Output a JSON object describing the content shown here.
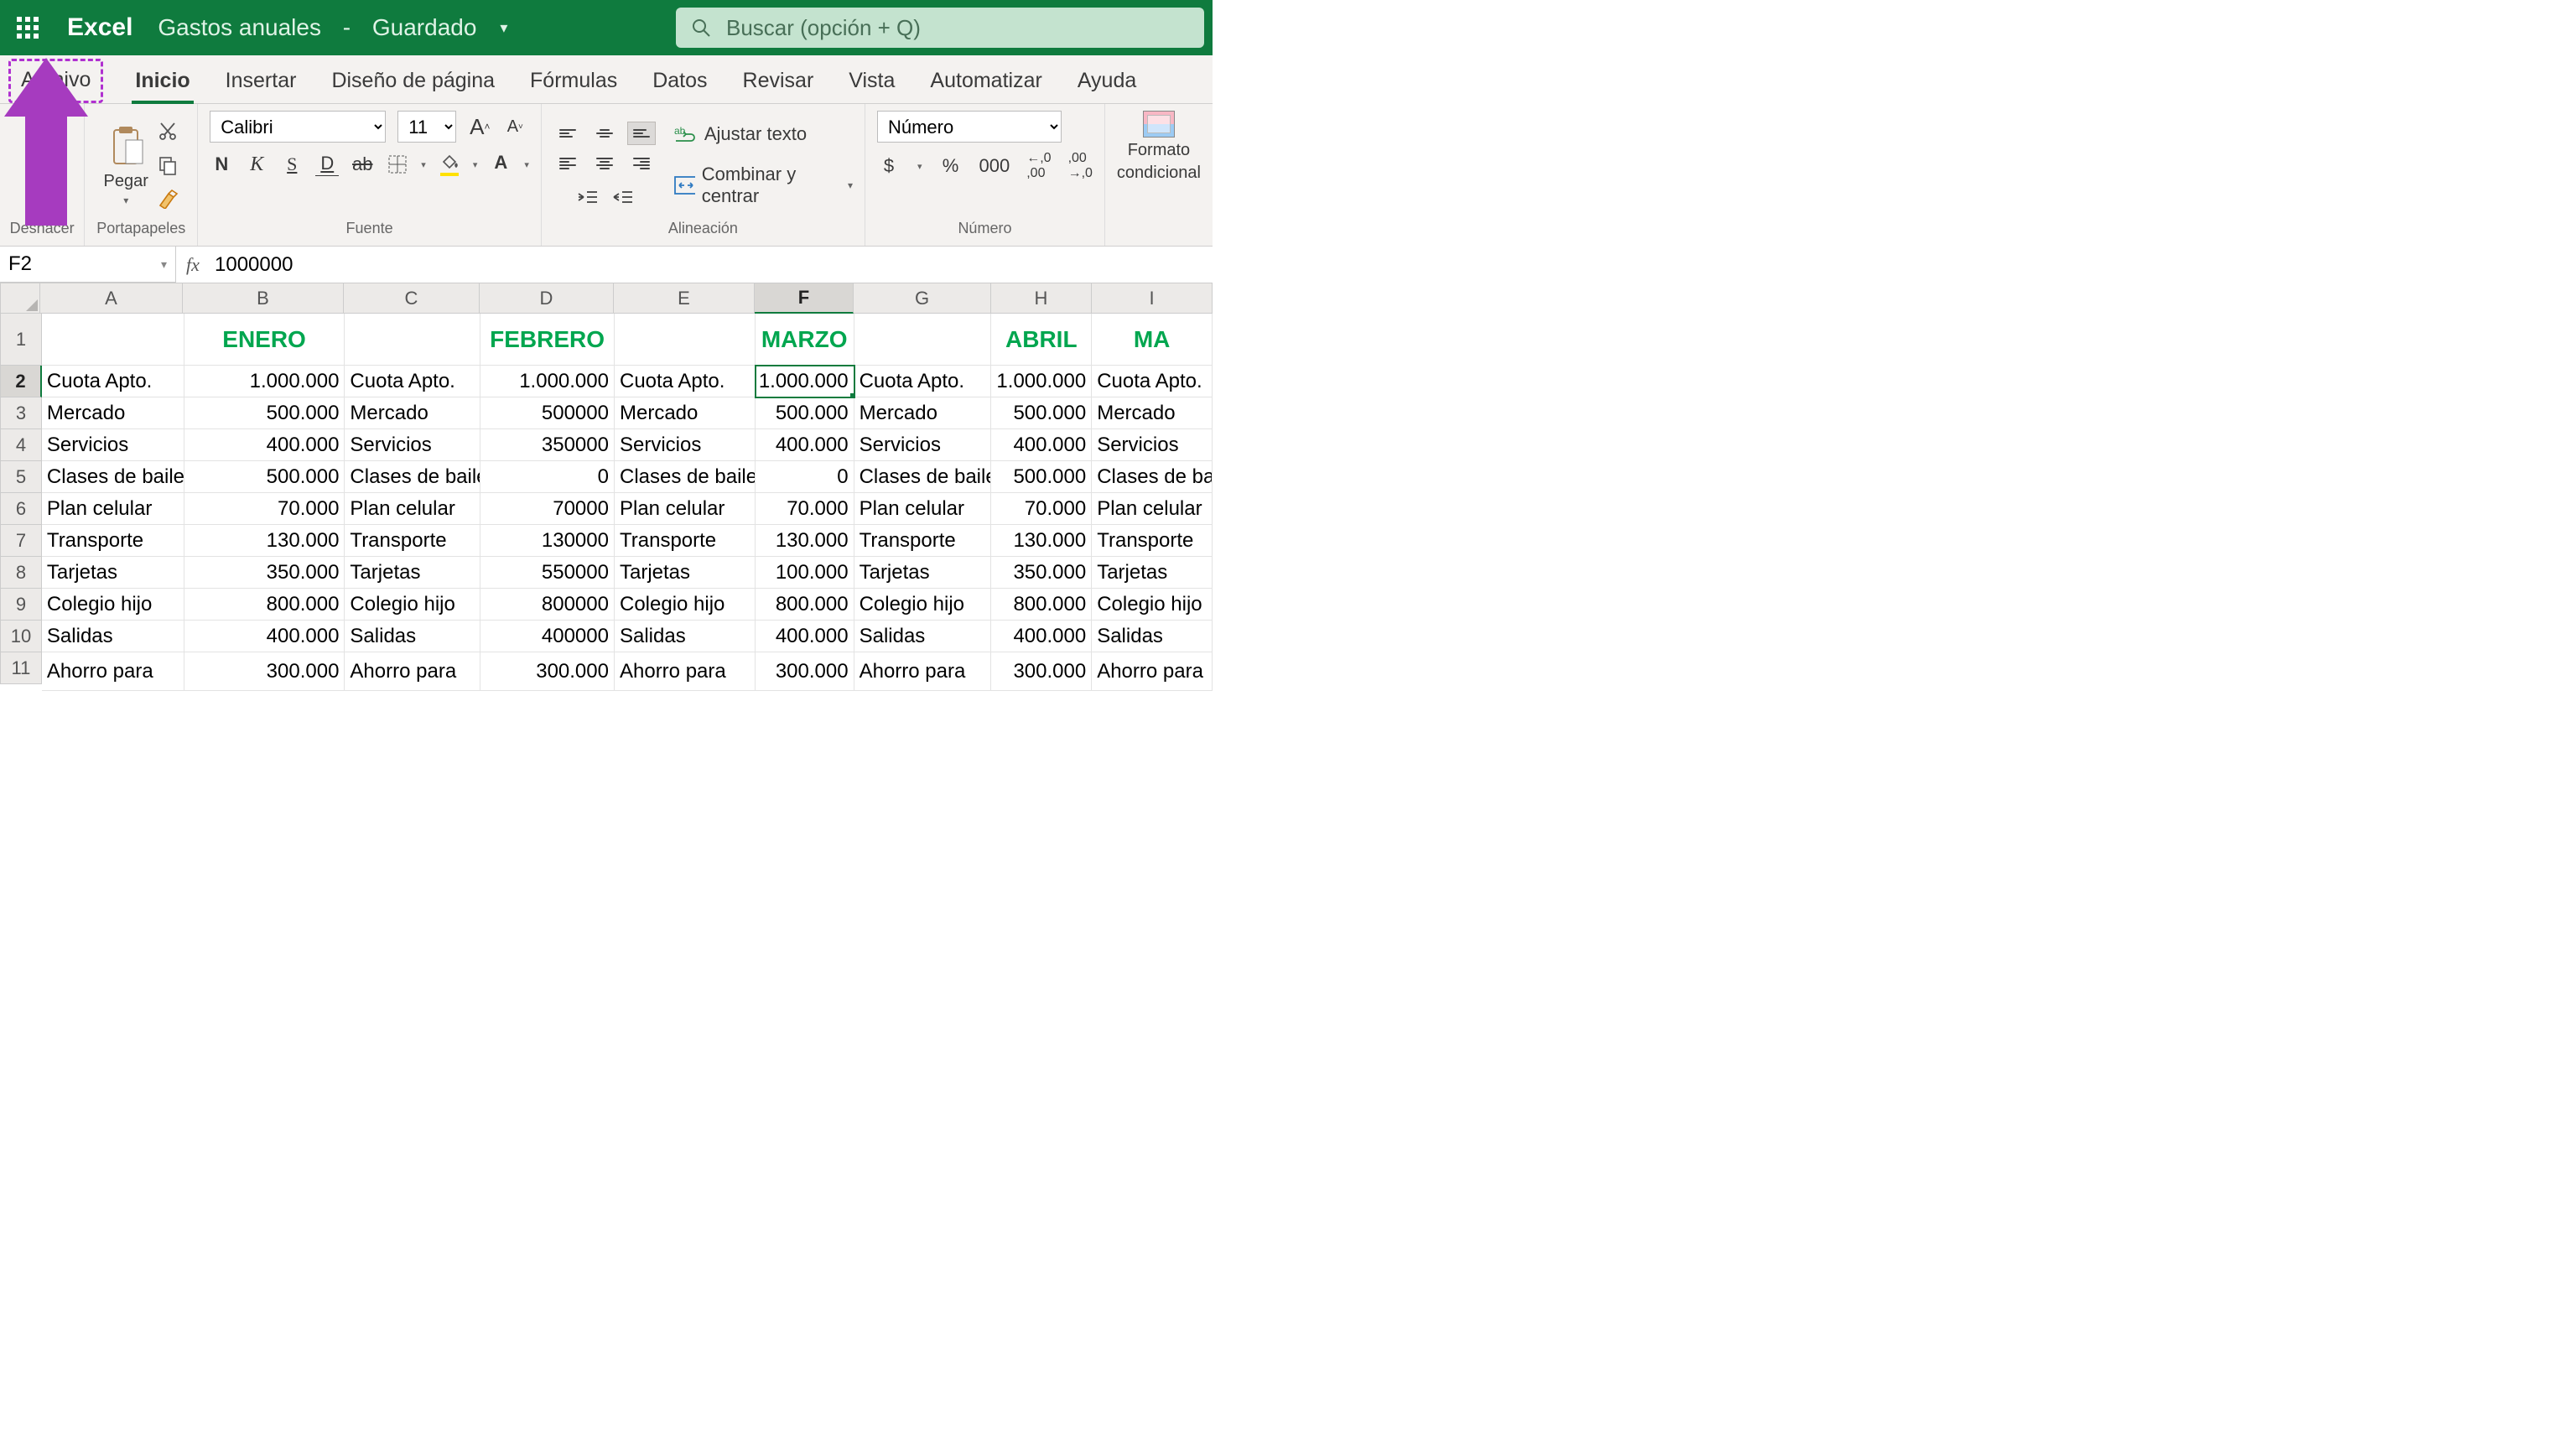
{
  "titlebar": {
    "app": "Excel",
    "doc": "Gastos anuales",
    "sep": "-",
    "status": "Guardado",
    "search_placeholder": "Buscar (opción + Q)"
  },
  "tabs": [
    "Archivo",
    "Inicio",
    "Insertar",
    "Diseño de página",
    "Fórmulas",
    "Datos",
    "Revisar",
    "Vista",
    "Automatizar",
    "Ayuda"
  ],
  "active_tab": "Inicio",
  "ribbon": {
    "groups": {
      "undo": "Deshacer",
      "clipboard": {
        "cap": "Portapapeles",
        "paste": "Pegar"
      },
      "font": {
        "cap": "Fuente",
        "name": "Calibri",
        "size": "11",
        "bold": "N",
        "italic": "K",
        "underline": "S",
        "dbl": "D",
        "strike": "ab"
      },
      "align": {
        "cap": "Alineación",
        "wrap": "Ajustar texto",
        "merge": "Combinar y centrar"
      },
      "number": {
        "cap": "Número",
        "format": "Número",
        "currency": "$",
        "percent": "%",
        "thousands": "000",
        "dec_inc": ",00",
        "dec_dec": ",00"
      },
      "cond": {
        "label1": "Formato",
        "label2": "condicional"
      }
    }
  },
  "formula_bar": {
    "name": "F2",
    "fx": "fx",
    "value": "1000000"
  },
  "columns": [
    {
      "id": "A",
      "w": 170
    },
    {
      "id": "B",
      "w": 192
    },
    {
      "id": "C",
      "w": 162
    },
    {
      "id": "D",
      "w": 160
    },
    {
      "id": "E",
      "w": 168
    },
    {
      "id": "F",
      "w": 118
    },
    {
      "id": "G",
      "w": 164
    },
    {
      "id": "H",
      "w": 120
    },
    {
      "id": "I",
      "w": 144
    }
  ],
  "selected_col": "F",
  "selected_row": 2,
  "selected_cell": "F2",
  "months_row": {
    "B": "ENERO",
    "D": "FEBRERO",
    "F": "MARZO",
    "H": "ABRIL",
    "I": "MA"
  },
  "rows": [
    {
      "n": 2,
      "c": {
        "A": "Cuota Apto.",
        "B": "1.000.000",
        "C": "Cuota Apto.",
        "D": "1.000.000",
        "E": "Cuota Apto.",
        "F": "1.000.000",
        "G": "Cuota Apto.",
        "H": "1.000.000",
        "I": "Cuota Apto."
      }
    },
    {
      "n": 3,
      "c": {
        "A": "Mercado",
        "B": "500.000",
        "C": "Mercado",
        "D": "500000",
        "E": "Mercado",
        "F": "500.000",
        "G": "Mercado",
        "H": "500.000",
        "I": "Mercado"
      }
    },
    {
      "n": 4,
      "c": {
        "A": "Servicios",
        "B": "400.000",
        "C": "Servicios",
        "D": "350000",
        "E": "Servicios",
        "F": "400.000",
        "G": "Servicios",
        "H": "400.000",
        "I": "Servicios"
      }
    },
    {
      "n": 5,
      "c": {
        "A": "Clases de baile",
        "B": "500.000",
        "C": "Clases de baile",
        "D": "0",
        "E": "Clases de baile",
        "F": "0",
        "G": "Clases de baile",
        "H": "500.000",
        "I": "Clases de bail"
      }
    },
    {
      "n": 6,
      "c": {
        "A": "Plan celular",
        "B": "70.000",
        "C": "Plan celular",
        "D": "70000",
        "E": "Plan celular",
        "F": "70.000",
        "G": "Plan celular",
        "H": "70.000",
        "I": "Plan celular"
      }
    },
    {
      "n": 7,
      "c": {
        "A": "Transporte",
        "B": "130.000",
        "C": "Transporte",
        "D": "130000",
        "E": "Transporte",
        "F": "130.000",
        "G": "Transporte",
        "H": "130.000",
        "I": "Transporte"
      }
    },
    {
      "n": 8,
      "c": {
        "A": "Tarjetas",
        "B": "350.000",
        "C": "Tarjetas",
        "D": "550000",
        "E": "Tarjetas",
        "F": "100.000",
        "G": "Tarjetas",
        "H": "350.000",
        "I": "Tarjetas"
      }
    },
    {
      "n": 9,
      "c": {
        "A": "Colegio hijo",
        "B": "800.000",
        "C": "Colegio hijo",
        "D": "800000",
        "E": "Colegio hijo",
        "F": "800.000",
        "G": "Colegio hijo",
        "H": "800.000",
        "I": "Colegio hijo"
      }
    },
    {
      "n": 10,
      "c": {
        "A": "Salidas",
        "B": "400.000",
        "C": "Salidas",
        "D": "400000",
        "E": "Salidas",
        "F": "400.000",
        "G": "Salidas",
        "H": "400.000",
        "I": "Salidas"
      }
    },
    {
      "n": 11,
      "c": {
        "A": "Ahorro para",
        "B": "300.000",
        "C": "Ahorro para",
        "D": "300.000",
        "E": "Ahorro para",
        "F": "300.000",
        "G": "Ahorro para",
        "H": "300.000",
        "I": "Ahorro para"
      }
    }
  ]
}
